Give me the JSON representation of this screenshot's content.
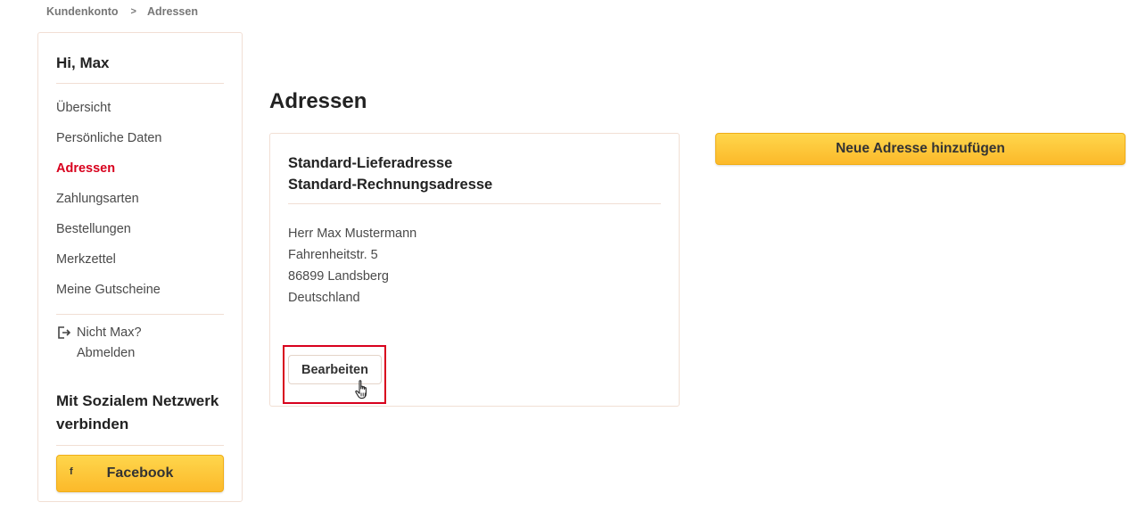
{
  "breadcrumb": {
    "items": [
      "Kundenkonto",
      "Adressen"
    ],
    "separator": ">"
  },
  "sidebar": {
    "greeting": "Hi, Max",
    "nav": [
      {
        "label": "Übersicht",
        "active": false
      },
      {
        "label": "Persönliche Daten",
        "active": false
      },
      {
        "label": "Adressen",
        "active": true
      },
      {
        "label": "Zahlungsarten",
        "active": false
      },
      {
        "label": "Bestellungen",
        "active": false
      },
      {
        "label": "Merkzettel",
        "active": false
      },
      {
        "label": "Meine Gutscheine",
        "active": false
      }
    ],
    "logout": {
      "question": "Nicht Max?",
      "label": "Abmelden",
      "icon": "logout-icon"
    },
    "social": {
      "title": "Mit Sozialem Netzwerk verbinden",
      "facebook_label": "Facebook",
      "facebook_icon_glyph": "f"
    }
  },
  "main": {
    "title": "Adressen",
    "card": {
      "heading_line1": "Standard-Lieferadresse",
      "heading_line2": "Standard-Rechnungsadresse",
      "address": [
        "Herr Max Mustermann",
        "Fahrenheitstr. 5",
        "86899 Landsberg",
        "Deutschland"
      ],
      "edit_label": "Bearbeiten"
    },
    "add_label": "Neue Adresse hinzufügen"
  },
  "colors": {
    "accent_red": "#d8001d",
    "button_yellow": "#fcb92a",
    "border": "#f1dfd4"
  }
}
